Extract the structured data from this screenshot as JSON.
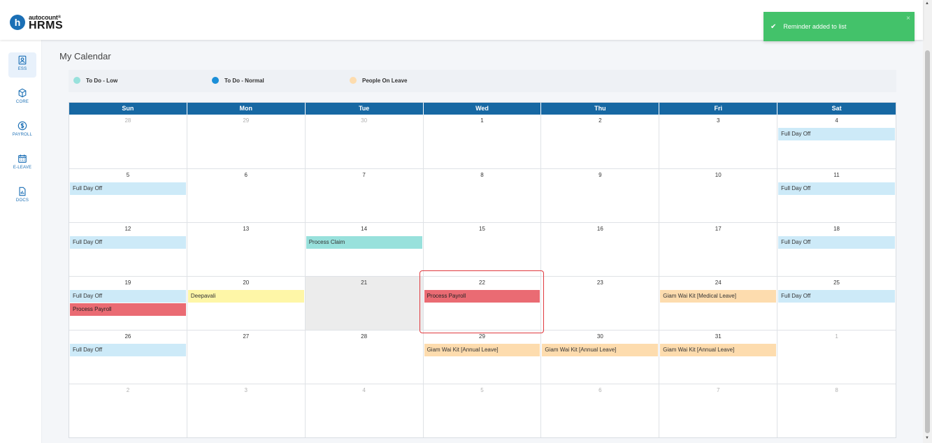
{
  "app": {
    "logo_top": "autocount",
    "logo_sup": "®",
    "logo_bottom": "HRMS",
    "logo_letter": "h"
  },
  "sidebar": {
    "items": [
      {
        "label": "ESS",
        "icon": "id-badge-icon"
      },
      {
        "label": "CORE",
        "icon": "cube-icon"
      },
      {
        "label": "PAYROLL",
        "icon": "dollar-icon"
      },
      {
        "label": "E-LEAVE",
        "icon": "calendar-icon"
      },
      {
        "label": "DOCS",
        "icon": "document-chart-icon"
      }
    ]
  },
  "page": {
    "title": "My Calendar"
  },
  "legend": [
    {
      "label": "To Do - Low",
      "color": "#98e1dc"
    },
    {
      "label": "To Do - Normal",
      "color": "#1b8fd8"
    },
    {
      "label": "People On Leave",
      "color": "#fddcae"
    }
  ],
  "calendar": {
    "weekdays": [
      "Sun",
      "Mon",
      "Tue",
      "Wed",
      "Thu",
      "Fri",
      "Sat"
    ],
    "weeks": [
      [
        {
          "d": "28",
          "other": true,
          "events": []
        },
        {
          "d": "29",
          "other": true,
          "events": []
        },
        {
          "d": "30",
          "other": true,
          "events": []
        },
        {
          "d": "1",
          "events": []
        },
        {
          "d": "2",
          "events": []
        },
        {
          "d": "3",
          "events": []
        },
        {
          "d": "4",
          "events": [
            {
              "t": "Full Day Off",
              "k": "off"
            }
          ]
        }
      ],
      [
        {
          "d": "5",
          "events": [
            {
              "t": "Full Day Off",
              "k": "off"
            }
          ]
        },
        {
          "d": "6",
          "events": []
        },
        {
          "d": "7",
          "events": []
        },
        {
          "d": "8",
          "events": []
        },
        {
          "d": "9",
          "events": []
        },
        {
          "d": "10",
          "events": []
        },
        {
          "d": "11",
          "events": [
            {
              "t": "Full Day Off",
              "k": "off"
            }
          ]
        }
      ],
      [
        {
          "d": "12",
          "events": [
            {
              "t": "Full Day Off",
              "k": "off"
            }
          ]
        },
        {
          "d": "13",
          "events": []
        },
        {
          "d": "14",
          "events": [
            {
              "t": "Process Claim",
              "k": "low"
            }
          ]
        },
        {
          "d": "15",
          "events": []
        },
        {
          "d": "16",
          "events": []
        },
        {
          "d": "17",
          "events": []
        },
        {
          "d": "18",
          "events": [
            {
              "t": "Full Day Off",
              "k": "off"
            }
          ]
        }
      ],
      [
        {
          "d": "19",
          "events": [
            {
              "t": "Full Day Off",
              "k": "off"
            },
            {
              "t": "Process Payroll",
              "k": "high"
            }
          ]
        },
        {
          "d": "20",
          "events": [
            {
              "t": "Deepavali",
              "k": "holiday"
            }
          ]
        },
        {
          "d": "21",
          "today": true,
          "events": []
        },
        {
          "d": "22",
          "events": [
            {
              "t": "Process Payroll",
              "k": "high"
            }
          ]
        },
        {
          "d": "23",
          "events": []
        },
        {
          "d": "24",
          "events": [
            {
              "t": "Giam Wai Kit [Medical Leave]",
              "k": "leave"
            }
          ]
        },
        {
          "d": "25",
          "events": [
            {
              "t": "Full Day Off",
              "k": "off"
            }
          ]
        }
      ],
      [
        {
          "d": "26",
          "events": [
            {
              "t": "Full Day Off",
              "k": "off"
            }
          ]
        },
        {
          "d": "27",
          "events": []
        },
        {
          "d": "28",
          "events": []
        },
        {
          "d": "29",
          "events": [
            {
              "t": "Giam Wai Kit [Annual Leave]",
              "k": "leave"
            }
          ]
        },
        {
          "d": "30",
          "events": [
            {
              "t": "Giam Wai Kit [Annual Leave]",
              "k": "leave"
            }
          ]
        },
        {
          "d": "31",
          "events": [
            {
              "t": "Giam Wai Kit [Annual Leave]",
              "k": "leave"
            }
          ]
        },
        {
          "d": "1",
          "other": true,
          "events": []
        }
      ],
      [
        {
          "d": "2",
          "other": true,
          "events": []
        },
        {
          "d": "3",
          "other": true,
          "events": []
        },
        {
          "d": "4",
          "other": true,
          "events": []
        },
        {
          "d": "5",
          "other": true,
          "events": []
        },
        {
          "d": "6",
          "other": true,
          "events": []
        },
        {
          "d": "7",
          "other": true,
          "events": []
        },
        {
          "d": "8",
          "other": true,
          "events": []
        }
      ]
    ]
  },
  "toast": {
    "message": "Reminder added to list",
    "close": "×"
  }
}
